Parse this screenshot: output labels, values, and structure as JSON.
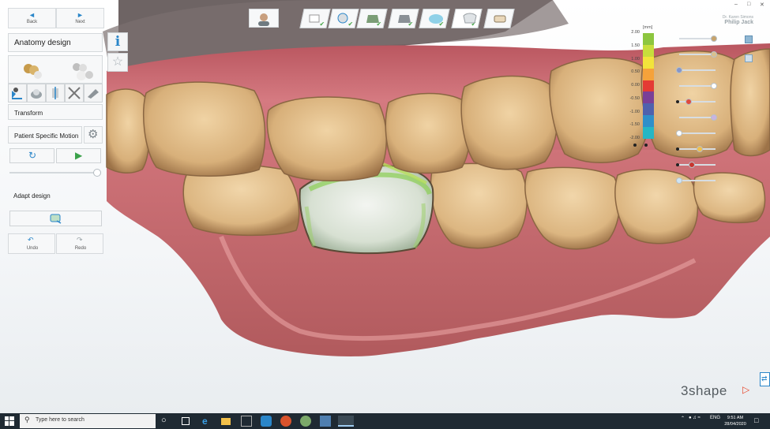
{
  "nav": {
    "back_label": "Back",
    "next_label": "Next"
  },
  "panel": {
    "section_title": "Anatomy design",
    "transform_label": "Transform",
    "psm_label": "Patient Specific Motion",
    "adapt_label": "Adapt design",
    "undo_label": "Undo",
    "redo_label": "Redo"
  },
  "header": {
    "user_line1": "Dr. Karen Simons",
    "user_line2": "Philip Jack"
  },
  "toolbar": {
    "steps": [
      "prepare",
      "margin",
      "insertion",
      "cement",
      "anatomy",
      "design",
      "finish"
    ],
    "done_steps": [
      true,
      true,
      true,
      true,
      true,
      true,
      false
    ]
  },
  "scale": {
    "unit": "[mm]",
    "ticks": [
      "2.00",
      "1.50",
      "1.00",
      "0.50",
      "0.00",
      "-0.50",
      "-1.00",
      "-1.50",
      "-2.00"
    ],
    "colors": [
      "#8dc63f",
      "#c7de3c",
      "#f2e43b",
      "#f6a23a",
      "#e43a34",
      "#7a3f97",
      "#4f61ad",
      "#2f8fc9",
      "#25b6c4"
    ]
  },
  "brand": {
    "logo_text": "3shape"
  },
  "taskbar": {
    "search_placeholder": "Type here to search",
    "language": "ENG",
    "time": "9:51 AM",
    "date": "28/04/2020"
  },
  "colors": {
    "accent": "#2a86c9",
    "brand": "#e8462a",
    "gum": "#c96a72",
    "tooth": "#d9b27c",
    "crown": "#dce8d8"
  }
}
